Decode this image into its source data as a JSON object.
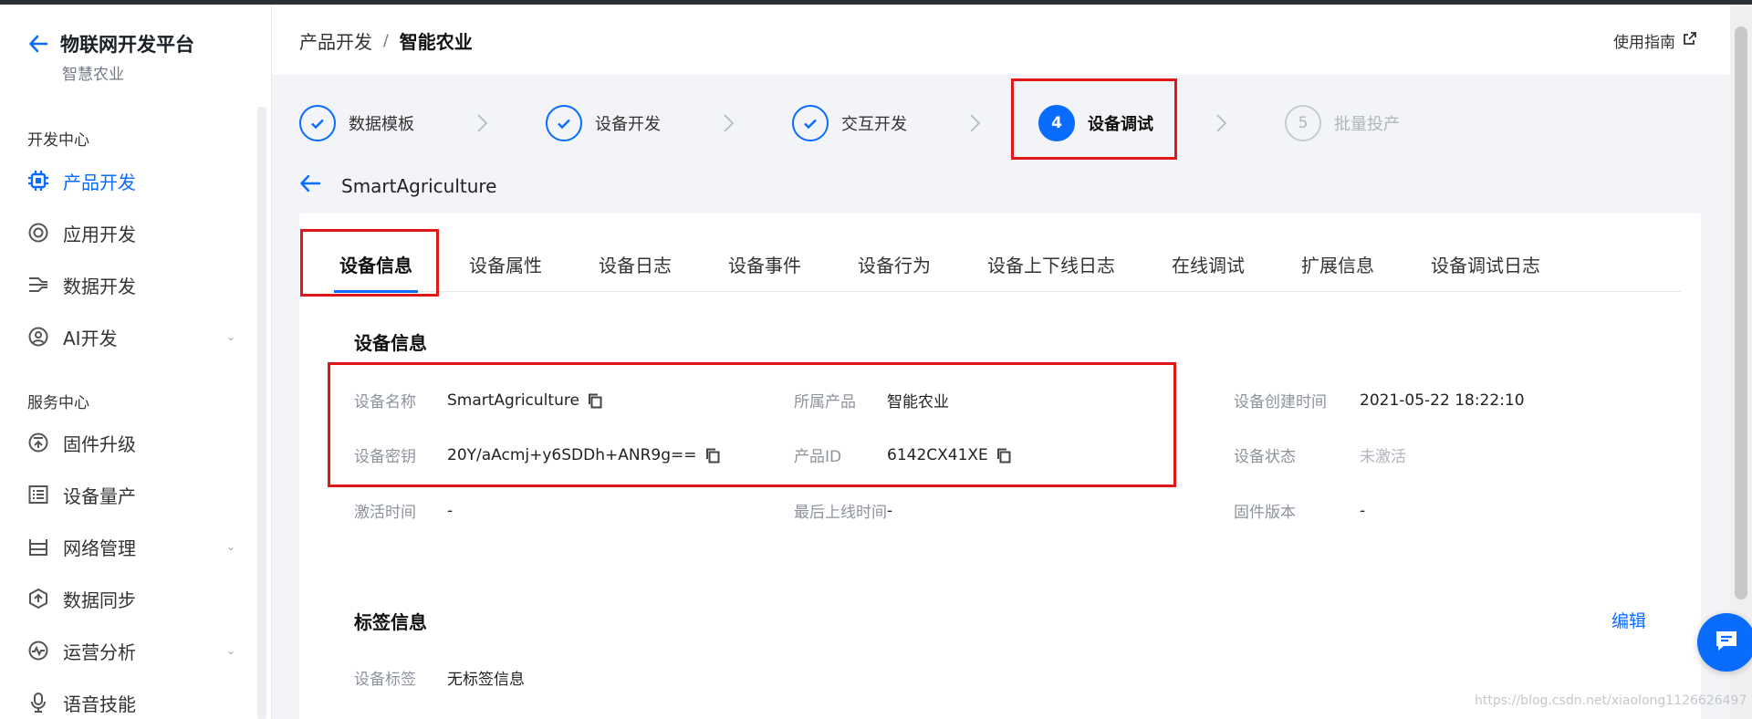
{
  "app": {
    "title": "物联网开发平台",
    "subtitle": "智慧农业"
  },
  "sidebar": {
    "sections": [
      {
        "title": "开发中心",
        "items": [
          {
            "label": "产品开发",
            "icon": "chip-icon",
            "active": true
          },
          {
            "label": "应用开发",
            "icon": "app-icon"
          },
          {
            "label": "数据开发",
            "icon": "data-flow-icon"
          },
          {
            "label": "AI开发",
            "icon": "ai-icon",
            "expandable": true
          }
        ]
      },
      {
        "title": "服务中心",
        "items": [
          {
            "label": "固件升级",
            "icon": "firmware-icon"
          },
          {
            "label": "设备量产",
            "icon": "list-icon"
          },
          {
            "label": "网络管理",
            "icon": "network-icon",
            "expandable": true
          },
          {
            "label": "数据同步",
            "icon": "sync-icon"
          },
          {
            "label": "运营分析",
            "icon": "analytics-icon",
            "expandable": true
          },
          {
            "label": "语音技能",
            "icon": "voice-icon"
          }
        ]
      }
    ]
  },
  "header": {
    "breadcrumb": [
      "产品开发",
      "智能农业"
    ],
    "separator": "/",
    "guide_label": "使用指南"
  },
  "steps": [
    {
      "index": "1",
      "label": "数据模板",
      "state": "done"
    },
    {
      "index": "2",
      "label": "设备开发",
      "state": "done"
    },
    {
      "index": "3",
      "label": "交互开发",
      "state": "done"
    },
    {
      "index": "4",
      "label": "设备调试",
      "state": "current"
    },
    {
      "index": "5",
      "label": "批量投产",
      "state": "pending"
    }
  ],
  "device": {
    "name": "SmartAgriculture"
  },
  "tabs": [
    {
      "label": "设备信息",
      "active": true
    },
    {
      "label": "设备属性"
    },
    {
      "label": "设备日志"
    },
    {
      "label": "设备事件"
    },
    {
      "label": "设备行为"
    },
    {
      "label": "设备上下线日志"
    },
    {
      "label": "在线调试"
    },
    {
      "label": "扩展信息"
    },
    {
      "label": "设备调试日志"
    }
  ],
  "info": {
    "title": "设备信息",
    "device_name_label": "设备名称",
    "device_name": "SmartAgriculture",
    "product_label": "所属产品",
    "product": "智能农业",
    "created_label": "设备创建时间",
    "created": "2021-05-22 18:22:10",
    "secret_label": "设备密钥",
    "secret": "20Y/aAcmj+y6SDDh+ANR9g==",
    "product_id_label": "产品ID",
    "product_id": "6142CX41XE",
    "status_label": "设备状态",
    "status": "未激活",
    "activated_label": "激活时间",
    "activated": "-",
    "last_online_label": "最后上线时间",
    "last_online": "-",
    "firmware_label": "固件版本",
    "firmware": "-"
  },
  "tags": {
    "title": "标签信息",
    "edit_label": "编辑",
    "tag_label": "设备标签",
    "tag_value": "无标签信息"
  },
  "watermark": "https://blog.csdn.net/xiaolong1126626497",
  "colors": {
    "accent": "#0a6cff",
    "highlight": "#e01818"
  }
}
